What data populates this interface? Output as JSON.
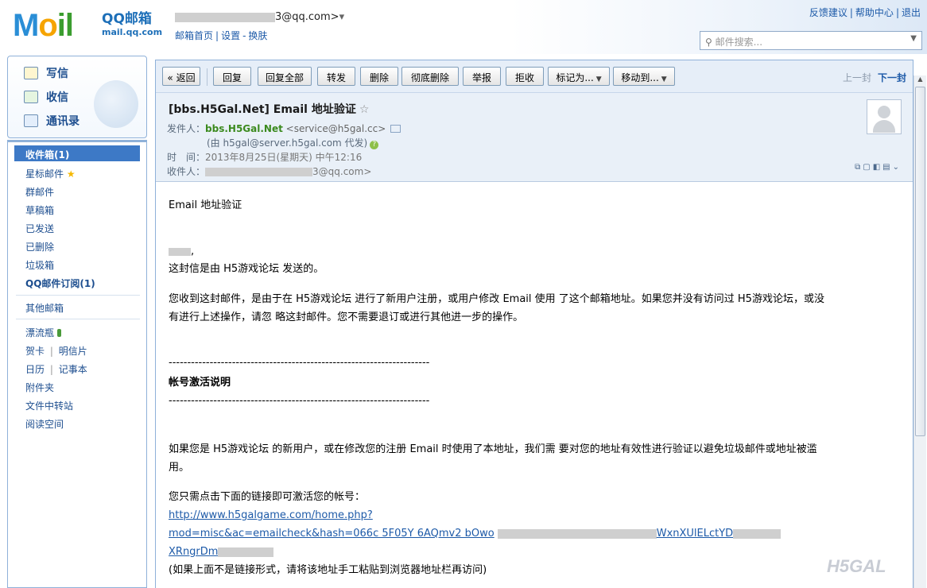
{
  "header": {
    "logo_text": "MOil",
    "brand_name": "QQ邮箱",
    "brand_domain": "mail.qq.com",
    "account": "3@qq.com>",
    "account_links": [
      "邮箱首页",
      "设置",
      "换肤"
    ],
    "top_links": [
      "反馈建议",
      "帮助中心",
      "退出"
    ],
    "search_placeholder": "邮件搜索..."
  },
  "sidebar": {
    "quick": [
      "写信",
      "收信",
      "通讯录"
    ],
    "active_folder": "收件箱(1)",
    "folders": [
      "星标邮件",
      "群邮件",
      "草稿箱",
      "已发送",
      "已删除",
      "垃圾箱"
    ],
    "subscription": "QQ邮件订阅(1)",
    "other_mailbox": "其他邮箱",
    "apps": [
      "漂流瓶",
      "贺卡",
      "明信片",
      "日历",
      "记事本",
      "附件夹",
      "文件中转站",
      "阅读空间"
    ]
  },
  "toolbar": {
    "back": "« 返回",
    "buttons": [
      "回复",
      "回复全部",
      "转发",
      "删除",
      "彻底删除",
      "举报",
      "拒收"
    ],
    "mark_as": "标记为...",
    "move_to": "移动到...",
    "prev": "上一封",
    "next": "下一封"
  },
  "message": {
    "subject": "[bbs.H5Gal.Net] Email 地址验证",
    "from_label": "发件人：",
    "sender_name": "bbs.H5Gal.Net",
    "sender_addr": "<service@h5gal.cc>",
    "on_behalf": "(由 h5gal@server.h5gal.com 代发)",
    "time_label": "时　间：",
    "time": "2013年8月25日(星期天) 中午12:16",
    "to_label": "收件人：",
    "to_addr": "3@qq.com>"
  },
  "body": {
    "title": "Email 地址验证",
    "greeting": ",",
    "line1": "这封信是由 H5游戏论坛 发送的。",
    "para2_l1": "您收到这封邮件，是由于在 H5游戏论坛 进行了新用户注册，或用户修改 Email 使用 了这个邮箱地址。如果您并没有访问过 H5游戏论坛，或没",
    "para2_l2": "有进行上述操作，请忽 略这封邮件。您不需要退订或进行其他进一步的操作。",
    "dashes": "----------------------------------------------------------------------",
    "section_title": "帐号激活说明",
    "para3_l1": "如果您是 H5游戏论坛 的新用户，或在修改您的注册 Email 时使用了本地址，我们需 要对您的地址有效性进行验证以避免垃圾邮件或地址被滥",
    "para3_l2": "用。",
    "para4": "您只需点击下面的链接即可激活您的帐号：",
    "link_l1": "http://www.h5galgame.com/home.php?",
    "link_l2": "mod=misc&ac=emailcheck&hash=066c      5F05Y      6AQmv2    bOwo",
    "link_l2b": "WxnXUlELctYD",
    "link_l3": "XRngrDm",
    "note": "(如果上面不是链接形式，请将该地址手工粘贴到浏览器地址栏再访问)"
  },
  "watermark": "H5GAL"
}
